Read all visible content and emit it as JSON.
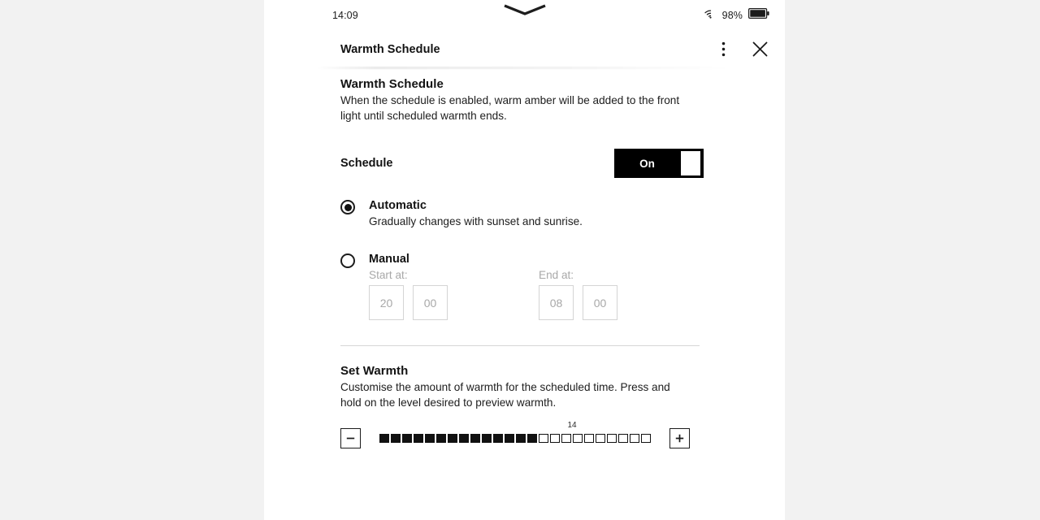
{
  "status_bar": {
    "time": "14:09",
    "battery_percent": "98%",
    "wifi_icon": "wifi-icon",
    "battery_icon": "battery-icon"
  },
  "header": {
    "title": "Warmth Schedule",
    "menu_icon": "overflow-menu-icon",
    "close_icon": "close-icon"
  },
  "main": {
    "section_title": "Warmth Schedule",
    "section_description": "When the schedule is enabled, warm amber will be added to the front light until scheduled warmth ends.",
    "schedule": {
      "label": "Schedule",
      "toggle_state": "On",
      "toggle_on": true
    },
    "options": [
      {
        "id": "automatic",
        "title": "Automatic",
        "subtitle": "Gradually changes with sunset and sunrise.",
        "selected": true
      },
      {
        "id": "manual",
        "title": "Manual",
        "subtitle": "",
        "selected": false
      }
    ],
    "time_pickers": {
      "start": {
        "label": "Start at:",
        "hours": "20",
        "minutes": "00"
      },
      "end": {
        "label": "End at:",
        "hours": "08",
        "minutes": "00"
      },
      "disabled": true
    },
    "set_warmth": {
      "title": "Set Warmth",
      "description": "Customise the amount of warmth for the scheduled time. Press and hold on the level desired to preview warmth.",
      "value": "14",
      "level": 14,
      "max": 24,
      "decrease_label": "−",
      "increase_label": "+",
      "decrease_icon": "minus-icon",
      "increase_icon": "plus-icon"
    }
  },
  "colors": {
    "page_background": "#f2f2f2",
    "screen_background": "#ffffff",
    "text_primary": "#131313",
    "text_muted": "#a8a8a8",
    "accent": "#000000",
    "divider": "#d6d6d6"
  }
}
